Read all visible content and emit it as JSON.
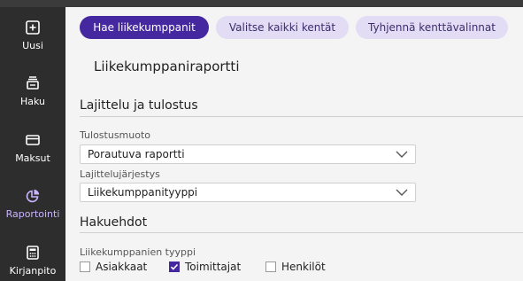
{
  "sidebar": {
    "items": [
      {
        "label": "Uusi",
        "icon": "plus-square-icon",
        "active": false
      },
      {
        "label": "Haku",
        "icon": "search-stack-icon",
        "active": false
      },
      {
        "label": "Maksut",
        "icon": "card-icon",
        "active": false
      },
      {
        "label": "Raportointi",
        "icon": "pie-chart-icon",
        "active": true
      },
      {
        "label": "Kirjanpito",
        "icon": "calculator-icon",
        "active": false
      }
    ]
  },
  "toolbar": {
    "primary_label": "Hae liikekumppanit",
    "select_all_label": "Valitse kaikki kentät",
    "clear_label": "Tyhjennä kenttävalinnat"
  },
  "page": {
    "title": "Liikekumppaniraportti"
  },
  "sorting": {
    "section_title": "Lajittelu ja tulostus",
    "format_label": "Tulostusmuoto",
    "format_value": "Porautuva raportti",
    "order_label": "Lajittelujärjestys",
    "order_value": "Liikekumppanityyppi"
  },
  "criteria": {
    "section_title": "Hakuehdot",
    "type_label": "Liikekumppanien tyyppi",
    "options": [
      {
        "label": "Asiakkaat",
        "checked": false
      },
      {
        "label": "Toimittajat",
        "checked": true
      },
      {
        "label": "Henkilöt",
        "checked": false
      }
    ]
  },
  "colors": {
    "accent": "#4527a0",
    "sidebar": "#2d2d2d",
    "active_nav": "#c9b4ff"
  }
}
